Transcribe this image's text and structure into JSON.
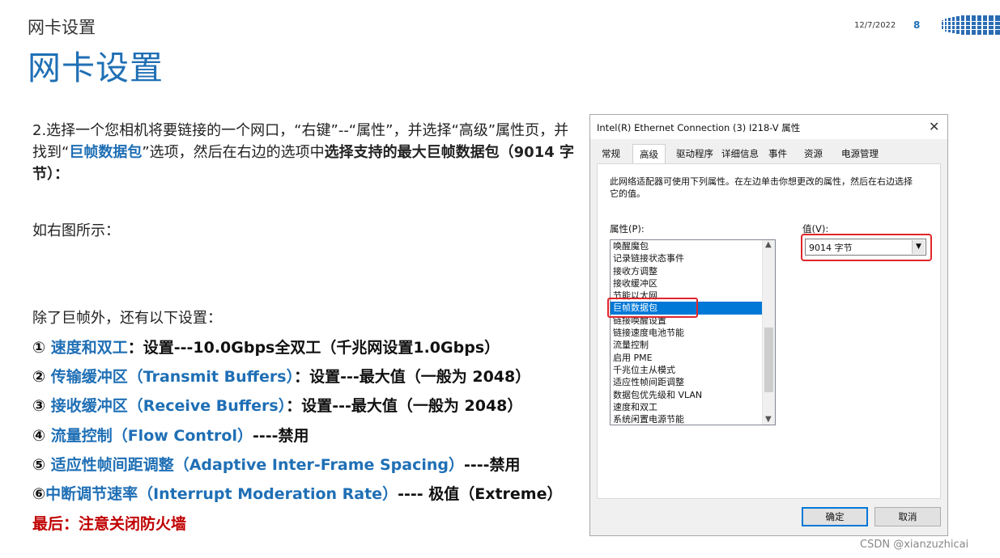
{
  "header": {
    "small_title": "网卡设置",
    "big_title": "网卡设置",
    "date": "12/7/2022",
    "page_number": "8"
  },
  "content": {
    "para1_a": "2.选择一个您相机将要链接的一个网口，“右键”--“属性”，并选择“高级”属性页，并找到“",
    "para1_highlight": "巨帧数据包",
    "para1_b": "”选项，然后在右边的选项中",
    "para1_bold": "选择支持的最大巨帧数据包（9014 字节）：",
    "para2": "如右图所示：",
    "para3": "除了巨帧外，还有以下设置：",
    "items": [
      {
        "num": "① ",
        "label": "速度和双工",
        "value": "：设置---10.0Gbps全双工（千兆网设置1.0Gbps）"
      },
      {
        "num": "② ",
        "label": "传输缓冲区（Transmit Buffers）",
        "value": "：设置---最大值（一般为 2048）"
      },
      {
        "num": "③ ",
        "label": "接收缓冲区（Receive Buffers）",
        "value": "：设置---最大值（一般为 2048）"
      },
      {
        "num": "④ ",
        "label": "流量控制（Flow Control）",
        "value": "----禁用"
      },
      {
        "num": "⑤ ",
        "label": "适应性帧间距调整（Adaptive Inter-Frame Spacing）",
        "value": "----禁用"
      },
      {
        "num": "⑥",
        "label": "中断调节速率（Interrupt Moderation Rate）",
        "value": "---- 极值（Extreme）"
      }
    ],
    "final": "最后：注意关闭防火墙"
  },
  "dialog": {
    "title": "Intel(R) Ethernet Connection (3) I218-V 属性",
    "close": "✕",
    "tabs": [
      "常规",
      "高级",
      "驱动程序",
      "详细信息",
      "事件",
      "资源",
      "电源管理"
    ],
    "description": "此网络适配器可使用下列属性。在左边单击你想更改的属性，然后在右边选择它的值。",
    "property_label": "属性(P):",
    "value_label": "值(V):",
    "properties": [
      "唤醒魔包",
      "记录链接状态事件",
      "接收方调整",
      "接收缓冲区",
      "节能以太网",
      "巨帧数据包",
      "链接唤醒设置",
      "链接速度电池节能",
      "流量控制",
      "启用 PME",
      "千兆位主从模式",
      "适应性帧间距调整",
      "数据包优先级和 VLAN",
      "速度和双工",
      "系统闲置电源节能"
    ],
    "selected_property": "巨帧数据包",
    "value": "9014 字节",
    "ok": "确定",
    "cancel": "取消"
  },
  "watermark": "CSDN @xianzuzhicai",
  "colors": {
    "accent": "#1f6fb5",
    "highlight_ring": "#e0262a",
    "final": "#c00000",
    "selection": "#0078d7"
  }
}
